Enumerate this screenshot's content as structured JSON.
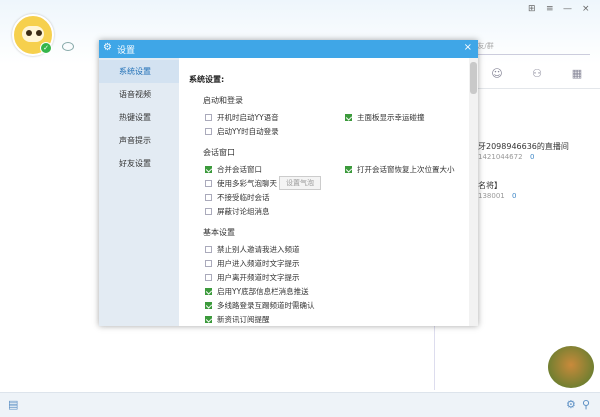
{
  "titlebar": {
    "skin_icon": "⊞",
    "menu_icon": "≡",
    "minimize": "—",
    "close": "×"
  },
  "search": {
    "placeholder": "搜索频道/好友/群"
  },
  "right_panel": {
    "item1_title": "牙2098946636的直播间",
    "item1_sub": "1421044672",
    "item1_count": "0",
    "item2_title": "名将】",
    "item2_sub": "138001",
    "item2_count": "0"
  },
  "dialog": {
    "title": "设置",
    "close": "×",
    "nav": [
      "系统设置",
      "语音视频",
      "热键设置",
      "声音提示",
      "好友设置"
    ],
    "section_title": "系统设置:",
    "startup": {
      "heading": "启动和登录",
      "options": [
        {
          "label": "开机时启动YY语音",
          "checked": false
        },
        {
          "label": "主面板显示幸运碰撞",
          "checked": true
        },
        {
          "label": "启动YY时自动登录",
          "checked": false
        }
      ]
    },
    "session": {
      "heading": "会话窗口",
      "options": [
        {
          "label": "合并会话窗口",
          "checked": true
        },
        {
          "label": "打开会话窗恢复上次位置大小",
          "checked": true
        },
        {
          "label": "使用多彩气泡聊天",
          "checked": false
        },
        {
          "label": "不接受临时会话",
          "checked": false
        },
        {
          "label": "屏蔽讨论组消息",
          "checked": false
        }
      ],
      "bubble_button": "设置气泡"
    },
    "basic": {
      "heading": "基本设置",
      "options": [
        {
          "label": "禁止别人邀请我进入频道",
          "checked": false
        },
        {
          "label": "用户进入频道时文字提示",
          "checked": false
        },
        {
          "label": "用户离开频道时文字提示",
          "checked": false
        },
        {
          "label": "启用YY底部信息栏消息推送",
          "checked": true
        },
        {
          "label": "多线路登录互踢频道时需确认",
          "checked": true
        },
        {
          "label": "新资讯订阅提醒",
          "checked": true
        }
      ]
    }
  }
}
